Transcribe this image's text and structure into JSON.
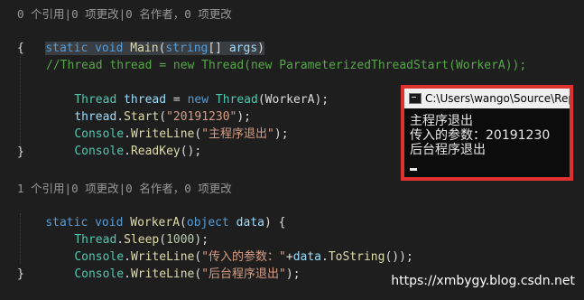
{
  "editor": {
    "lens1": "0 个引用|0 项更改|0 名作者，0 项更改",
    "lens2": "1 个引用|0 项更改|0 名作者，0 项更改",
    "main_sig": {
      "kw1": "static",
      "kw2": "void",
      "name": "Main",
      "p1": "(",
      "type": "string",
      "p2": "[] ",
      "param": "args",
      "p3": ")"
    },
    "open_brace": "{",
    "close_brace": "}",
    "line_comment": "//Thread thread = new Thread(new ParameterizedThreadStart(WorkerA));",
    "line_thread": {
      "type": "Thread",
      "var": " thread",
      "op": " = ",
      "kw": "new",
      "type2": " Thread",
      "rest": "(WorkerA);"
    },
    "line_start": {
      "obj": "thread",
      "dot": ".",
      "fn": "Start",
      "p1": "(",
      "str": "\"20191230\"",
      "p2": ");"
    },
    "line_write1": {
      "obj": "Console",
      "dot": ".",
      "fn": "WriteLine",
      "p1": "(",
      "str": "\"主程序退出\"",
      "p2": ");"
    },
    "line_readkey": {
      "obj": "Console",
      "dot": ".",
      "fn": "ReadKey",
      "p": "();"
    },
    "worker_sig": {
      "kw1": "static",
      "kw2": "void",
      "name": "WorkerA",
      "p1": "(",
      "kw3": "object",
      "param": " data",
      "p2": ") {"
    },
    "line_sleep": {
      "obj": "Thread",
      "dot": ".",
      "fn": "Sleep",
      "p1": "(",
      "num": "1000",
      "p2": ");"
    },
    "line_write2": {
      "obj": "Console",
      "dot": ".",
      "fn": "WriteLine",
      "p1": "(",
      "str": "\"传入的参数：\"",
      "plus": "+",
      "var": "data",
      "dot2": ".",
      "fn2": "ToString",
      "p2": "());"
    },
    "line_write3": {
      "obj": "Console",
      "dot": ".",
      "fn": "WriteLine",
      "p1": "(",
      "str": "\"后台程序退出\"",
      "p2": ");"
    }
  },
  "console": {
    "title": "C:\\Users\\wango\\Source\\Rep",
    "lines": [
      "主程序退出",
      "传入的参数：20191230",
      "后台程序退出"
    ]
  },
  "watermark": "https://xmbygy.blog.csdn.net"
}
